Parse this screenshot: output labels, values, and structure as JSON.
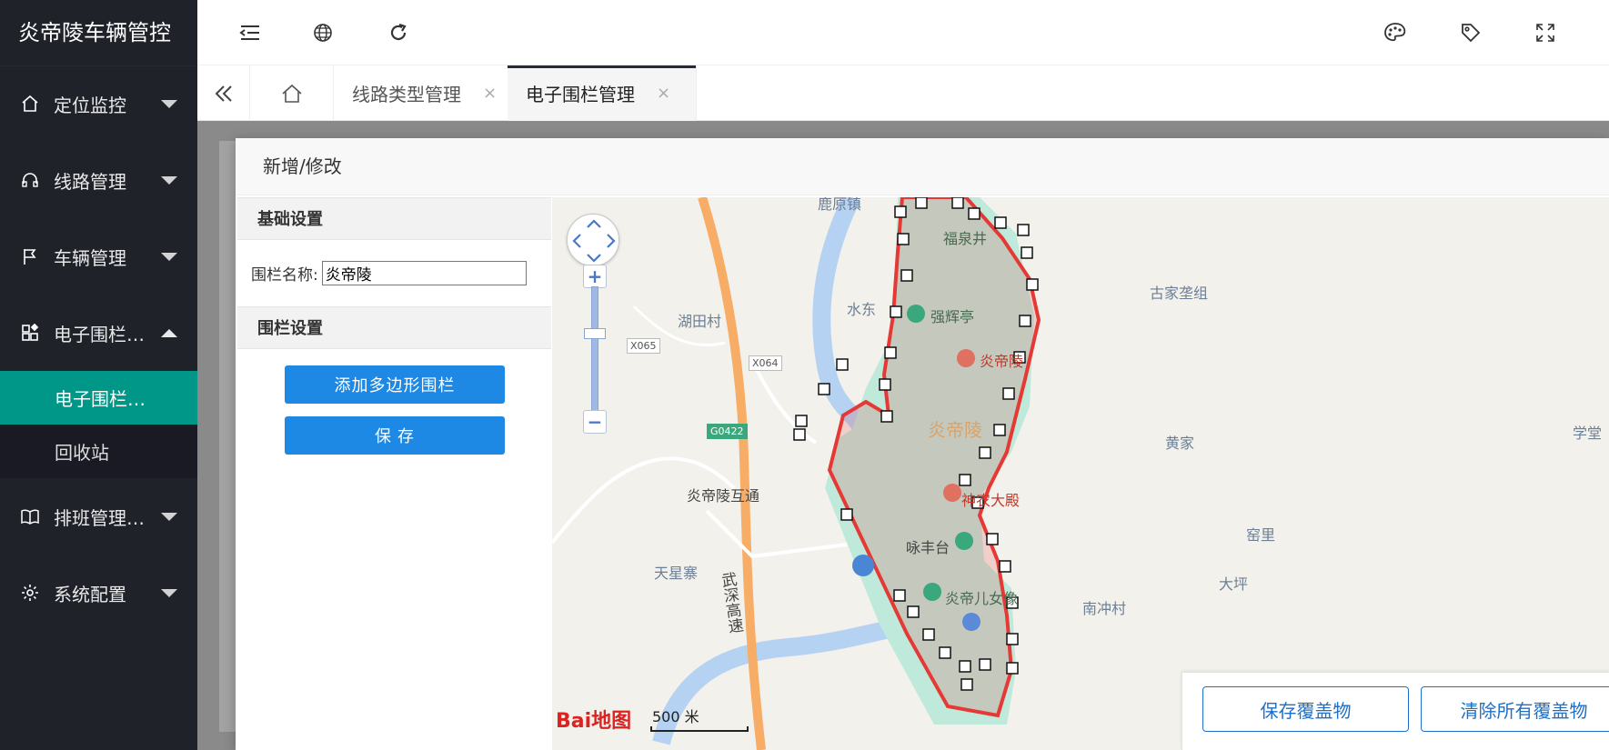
{
  "app": {
    "title": "炎帝陵车辆管控"
  },
  "sidebar": {
    "items": [
      {
        "label": "定位监控",
        "icon": "home-icon"
      },
      {
        "label": "线路管理",
        "icon": "headset-icon"
      },
      {
        "label": "车辆管理",
        "icon": "flag-icon"
      },
      {
        "label": "电子围栏…",
        "icon": "apps-icon"
      },
      {
        "label": "排班管理…",
        "icon": "book-icon"
      },
      {
        "label": "系统配置",
        "icon": "gear-icon"
      }
    ],
    "submenu": [
      {
        "label": "电子围栏…"
      },
      {
        "label": "回收站"
      }
    ]
  },
  "tabs": [
    {
      "label": "线路类型管理",
      "close": "×"
    },
    {
      "label": "电子围栏管理",
      "close": "×"
    }
  ],
  "dialog": {
    "title": "新增/修改",
    "basic_section": "基础设置",
    "fence_name_label": "围栏名称:",
    "fence_name_value": "炎帝陵",
    "fence_section": "围栏设置",
    "add_polygon_button": "添加多边形围栏",
    "save_button": "保 存"
  },
  "map": {
    "labels": {
      "luyuan": "鹿原镇",
      "fuquanjing": "福泉井",
      "shuidong": "水东",
      "qianghuiting": "强辉亭",
      "yandiling_poi": "炎帝陵",
      "yandiling_area": "炎帝陵",
      "hutiancun": "湖田村",
      "gujiazuan": "古家垄组",
      "huangjia": "黄家",
      "xuetang": "学堂",
      "yandiling_hutong": "炎帝陵互通",
      "shennong": "神农大殿",
      "yongfengtai": "咏丰台",
      "yaoli": "窑里",
      "tianxingzhai": "天星寨",
      "daping": "大坪",
      "wushen": "武深高速",
      "nanchongcun": "南冲村",
      "yandi_statue": "炎帝儿女像"
    },
    "road_badges": {
      "x065": "X065",
      "x064": "X064",
      "g0422": "G0422"
    },
    "logo_text": "Bai地图",
    "scale": "500 米",
    "zoom_in": "+",
    "zoom_out": "−"
  },
  "cover": {
    "save": "保存覆盖物",
    "clear": "清除所有覆盖物"
  },
  "colors": {
    "sidebar_bg": "#20222a",
    "active_green": "#009688",
    "primary_blue": "#1e88e5",
    "fence_red": "#e53935",
    "park_green": "#bfeadb"
  }
}
